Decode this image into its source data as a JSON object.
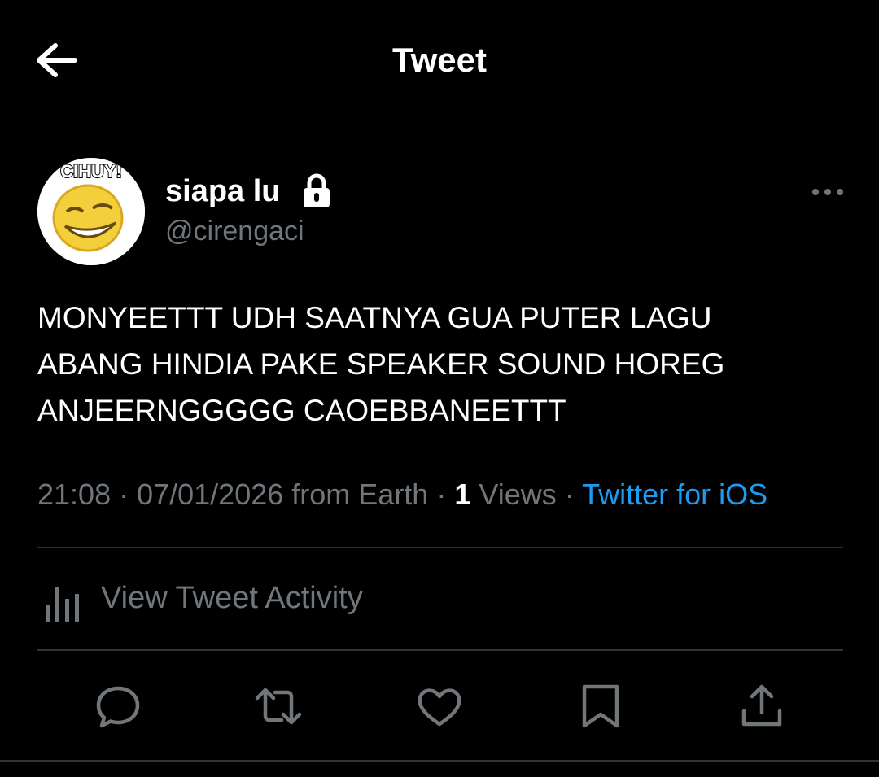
{
  "header": {
    "title": "Tweet",
    "back_icon": "arrow-left-icon"
  },
  "author": {
    "display_name": "siapa lu",
    "handle": "@cirengaci",
    "avatar_caption": "CIHUY!",
    "protected_icon": "lock-icon"
  },
  "tweet": {
    "lines": [
      "MONYEETTT UDH SAATNYA GUA PUTER LAGU",
      "ABANG HINDIA PAKE SPEAKER SOUND HOREG",
      "ANJEERNGGGGG CAOEBBANEETTT"
    ]
  },
  "meta": {
    "time": "21:08",
    "sep1": " · ",
    "date": "07/01/2026",
    "location": " from Earth",
    "sep2": " · ",
    "views_count": "1",
    "views_label": " Views",
    "sep3": " · ",
    "source": "Twitter for iOS"
  },
  "activity": {
    "label": "View Tweet Activity",
    "icon": "analytics-icon"
  },
  "actions": [
    "reply-icon",
    "retweet-icon",
    "like-icon",
    "bookmark-icon",
    "share-icon"
  ],
  "colors": {
    "background": "#000000",
    "muted": "#71767b",
    "accent": "#1d9bf0",
    "divider": "#2f3336"
  }
}
